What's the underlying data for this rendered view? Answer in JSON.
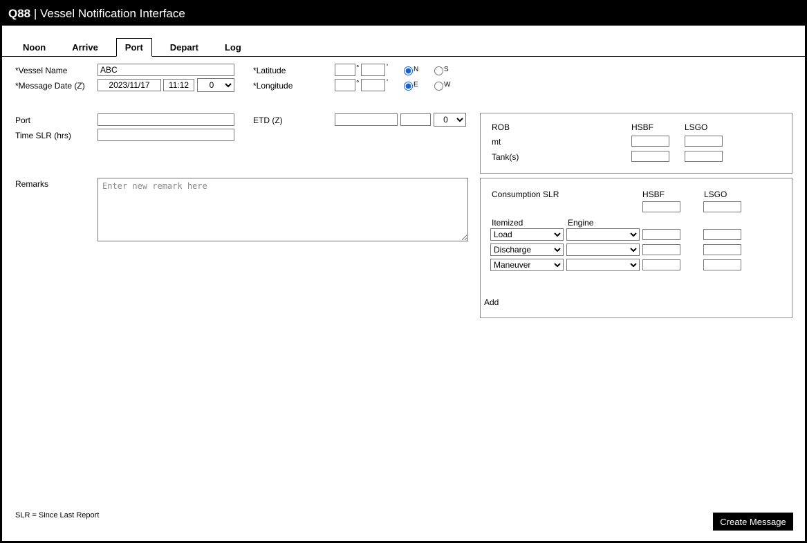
{
  "header": {
    "brand": "Q88",
    "separator": " | ",
    "title": "Vessel Notification Interface"
  },
  "tabs": [
    {
      "label": "Noon",
      "active": false
    },
    {
      "label": "Arrive",
      "active": false
    },
    {
      "label": "Port",
      "active": true
    },
    {
      "label": "Depart",
      "active": false
    },
    {
      "label": "Log",
      "active": false
    }
  ],
  "form": {
    "vessel_name": {
      "label": "*Vessel Name",
      "value": "ABC"
    },
    "message_date": {
      "label": "*Message Date (Z)",
      "date": "2023/11/17",
      "time": "11:12",
      "offset": "0"
    },
    "latitude": {
      "label": "*Latitude",
      "deg": "",
      "min": "",
      "deg_symbol": "°",
      "min_symbol": "'",
      "north_label": "N",
      "south_label": "S",
      "selected_hemisphere": "N"
    },
    "longitude": {
      "label": "*Longitude",
      "deg": "",
      "min": "",
      "deg_symbol": "°",
      "min_symbol": "'",
      "east_label": "E",
      "west_label": "W",
      "selected_hemisphere": "E"
    },
    "port": {
      "label": "Port",
      "value": ""
    },
    "etd": {
      "label": "ETD (Z)",
      "date": "",
      "time": "",
      "offset": "0"
    },
    "time_slr": {
      "label": "Time SLR (hrs)",
      "value": ""
    },
    "remarks": {
      "label": "Remarks",
      "placeholder": "Enter new remark here",
      "value": ""
    }
  },
  "rob_panel": {
    "title": "ROB",
    "col_hsbf": "HSBF",
    "col_lsgo": "LSGO",
    "rows": [
      {
        "label": "mt",
        "hsbf": "",
        "lsgo": ""
      },
      {
        "label": "Tank(s)",
        "hsbf": "",
        "lsgo": ""
      }
    ]
  },
  "consumption_panel": {
    "title": "Consumption SLR",
    "col_hsbf": "HSBF",
    "col_lsgo": "LSGO",
    "hsbf_total": "",
    "lsgo_total": "",
    "itemized_header": "Itemized",
    "engine_header": "Engine",
    "rows": [
      {
        "itemized": "Load",
        "engine": "",
        "hsbf": "",
        "lsgo": ""
      },
      {
        "itemized": "Discharge",
        "engine": "",
        "hsbf": "",
        "lsgo": ""
      },
      {
        "itemized": "Maneuver",
        "engine": "",
        "hsbf": "",
        "lsgo": ""
      }
    ],
    "add_label": "Add"
  },
  "footer": {
    "note": "SLR = Since Last Report",
    "create_button_label": "Create Message"
  }
}
